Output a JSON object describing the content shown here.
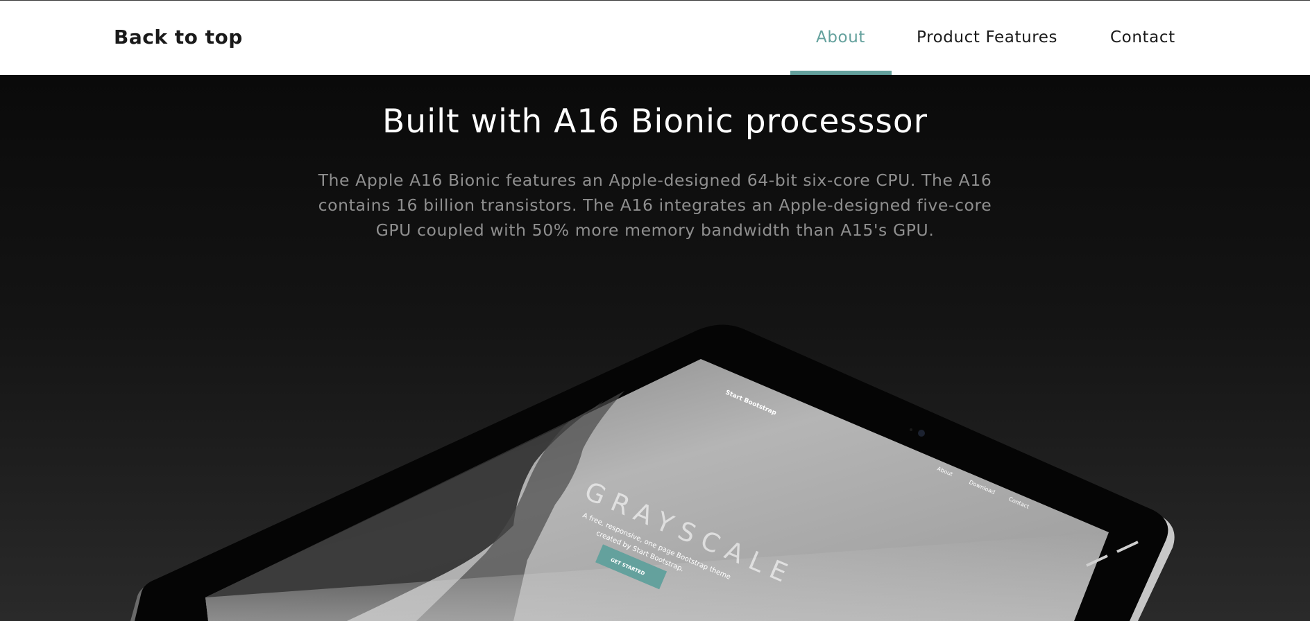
{
  "nav": {
    "brand": "Back to top",
    "links": [
      {
        "label": "About",
        "active": true
      },
      {
        "label": "Product Features",
        "active": false
      },
      {
        "label": "Contact",
        "active": false
      }
    ]
  },
  "section": {
    "title": "Built with A16 Bionic processsor",
    "description": "The Apple A16 Bionic features an Apple-designed 64-bit six-core CPU. The A16 contains 16 billion transistors. The A16 integrates an Apple-designed five-core GPU coupled with 50% more memory bandwidth than A15's GPU."
  },
  "device_screen": {
    "brand": "Start Bootstrap",
    "nav": [
      "About",
      "Download",
      "Contact"
    ],
    "heading": "GRAYSCALE",
    "tagline_line1": "A free, responsive, one page Bootstrap theme",
    "tagline_line2": "created by Start Bootstrap.",
    "cta": "GET STARTED"
  },
  "colors": {
    "accent": "#64a19d",
    "nav_bg": "#ffffff",
    "section_bg": "#111111",
    "title": "#ffffff",
    "description": "#8f8f8f"
  },
  "icons": [
    "tablet-device-image"
  ]
}
